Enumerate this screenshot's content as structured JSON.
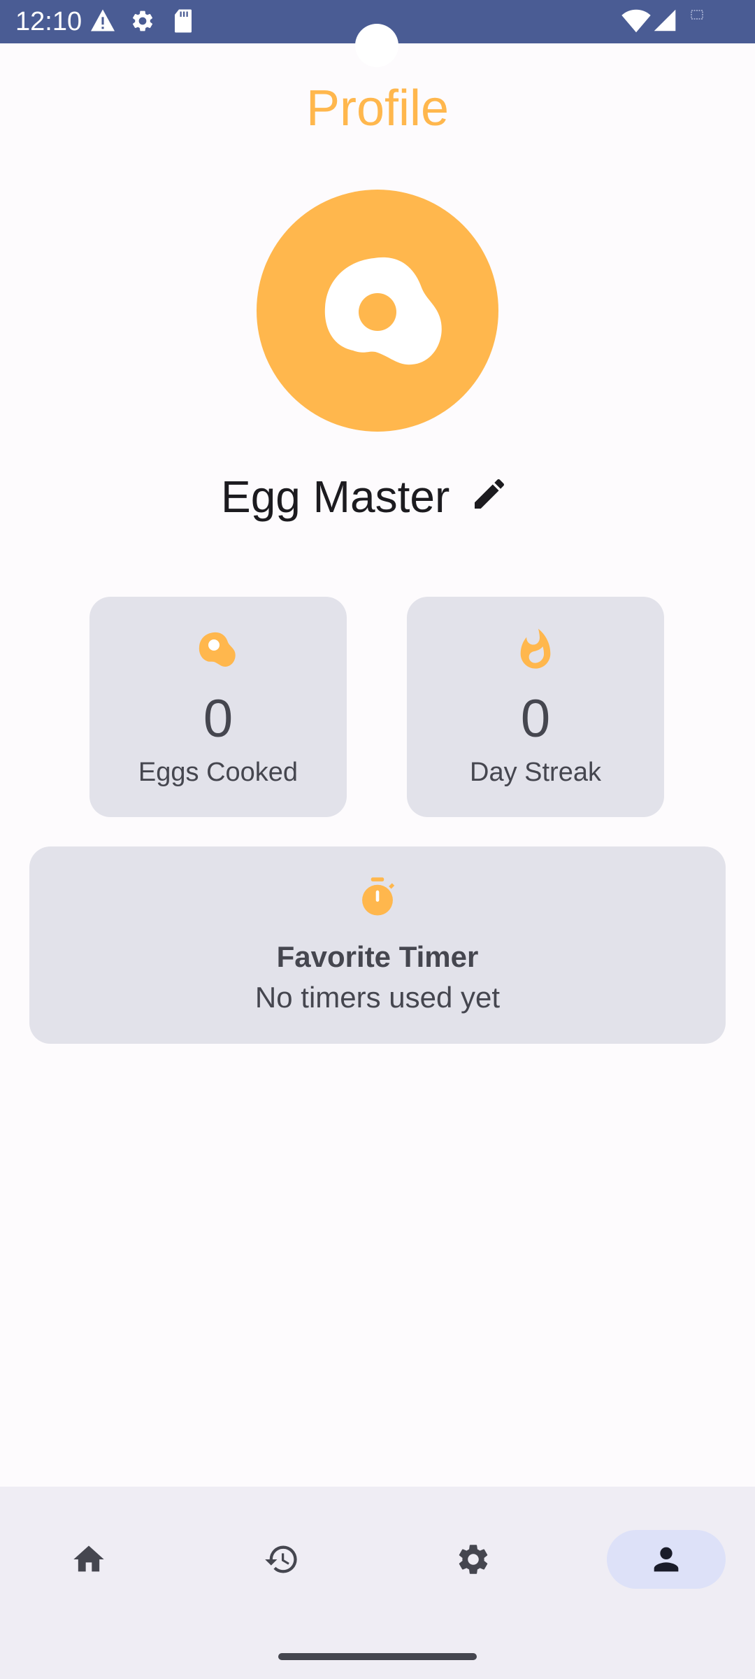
{
  "status_bar": {
    "time": "12:10",
    "icons": [
      "alert-icon",
      "gear-icon",
      "sd-card-icon",
      "wifi-icon",
      "signal-icon",
      "battery-icon"
    ],
    "background": "#4A5C94"
  },
  "header": {
    "title": "Profile"
  },
  "profile": {
    "avatar_icon": "fried-egg-icon",
    "name": "Egg Master",
    "edit_icon": "pencil-icon"
  },
  "stats": [
    {
      "icon": "egg-icon",
      "value": "0",
      "label": "Eggs Cooked"
    },
    {
      "icon": "flame-icon",
      "value": "0",
      "label": "Day Streak"
    }
  ],
  "favorite_timer": {
    "icon": "stopwatch-icon",
    "title": "Favorite Timer",
    "subtitle": "No timers used yet"
  },
  "bottom_nav": {
    "items": [
      {
        "icon": "home-icon",
        "selected": false
      },
      {
        "icon": "history-icon",
        "selected": false
      },
      {
        "icon": "settings-icon",
        "selected": false
      },
      {
        "icon": "person-icon",
        "selected": true
      }
    ]
  },
  "colors": {
    "accent": "#FFB74D",
    "card_background": "#E2E2EA",
    "text_primary": "#1C1B1F",
    "text_secondary": "#45464F",
    "nav_background": "#EFEDF4",
    "nav_selected": "#DDE1F8"
  }
}
